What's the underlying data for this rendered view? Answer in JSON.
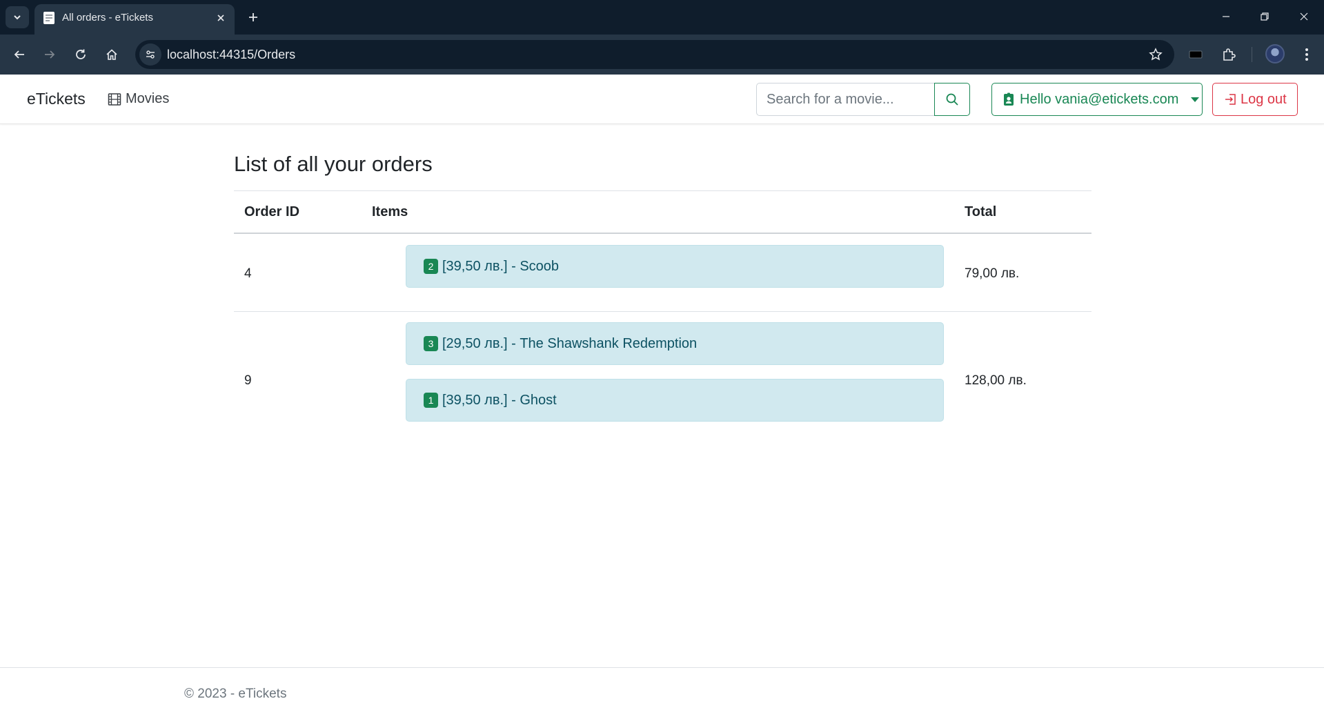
{
  "browser": {
    "tab_title": "All orders - eTickets",
    "url": "localhost:44315/Orders"
  },
  "navbar": {
    "brand": "eTickets",
    "movies_label": "Movies",
    "search_placeholder": "Search for a movie...",
    "user_label": "Hello vania@etickets.com",
    "logout_label": "Log out"
  },
  "main": {
    "title": "List of all your orders",
    "columns": [
      "Order ID",
      "Items",
      "Total"
    ],
    "orders": [
      {
        "id": "4",
        "items": [
          {
            "quantity": "2",
            "text": "[39,50 лв.] - Scoob"
          }
        ],
        "total": "79,00 лв."
      },
      {
        "id": "9",
        "items": [
          {
            "quantity": "3",
            "text": "[29,50 лв.] - The Shawshank Redemption"
          },
          {
            "quantity": "1",
            "text": "[39,50 лв.] - Ghost"
          }
        ],
        "total": "128,00 лв."
      }
    ]
  },
  "footer": {
    "text": "© 2023 - eTickets"
  },
  "colors": {
    "success": "#198754",
    "danger": "#dc3545",
    "info_bg": "#d1e9ef",
    "chrome_dark": "#0f1d2c",
    "chrome_mid": "#263646"
  }
}
